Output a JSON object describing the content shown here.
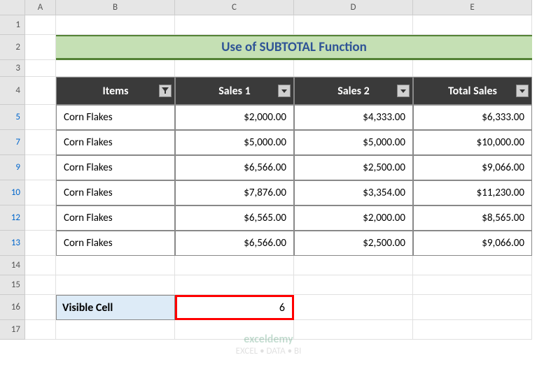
{
  "columns": [
    "A",
    "B",
    "C",
    "D",
    "E"
  ],
  "rows_labels": [
    "1",
    "2",
    "3",
    "4",
    "5",
    "7",
    "9",
    "10",
    "12",
    "13",
    "14",
    "15",
    "16",
    "17"
  ],
  "filtered_rows": [
    "5",
    "7",
    "9",
    "10",
    "12",
    "13"
  ],
  "title": "Use of SUBTOTAL Function",
  "table": {
    "headers": [
      "Items",
      "Sales 1",
      "Sales 2",
      "Total Sales"
    ],
    "rows": [
      {
        "item": "Corn Flakes",
        "s1": "$2,000.00",
        "s2": "$4,333.00",
        "tot": "$6,333.00"
      },
      {
        "item": "Corn Flakes",
        "s1": "$5,000.00",
        "s2": "$5,000.00",
        "tot": "$10,000.00"
      },
      {
        "item": "Corn Flakes",
        "s1": "$6,566.00",
        "s2": "$2,500.00",
        "tot": "$9,066.00"
      },
      {
        "item": "Corn Flakes",
        "s1": "$7,876.00",
        "s2": "$3,354.00",
        "tot": "$11,230.00"
      },
      {
        "item": "Corn Flakes",
        "s1": "$6,565.00",
        "s2": "$2,000.00",
        "tot": "$8,565.00"
      },
      {
        "item": "Corn Flakes",
        "s1": "$6,566.00",
        "s2": "$2,500.00",
        "tot": "$9,066.00"
      }
    ]
  },
  "visible_cell": {
    "label": "Visible Cell",
    "value": "6"
  },
  "watermark": {
    "brand": "exceldemy",
    "tagline": "EXCEL • DATA • BI"
  }
}
